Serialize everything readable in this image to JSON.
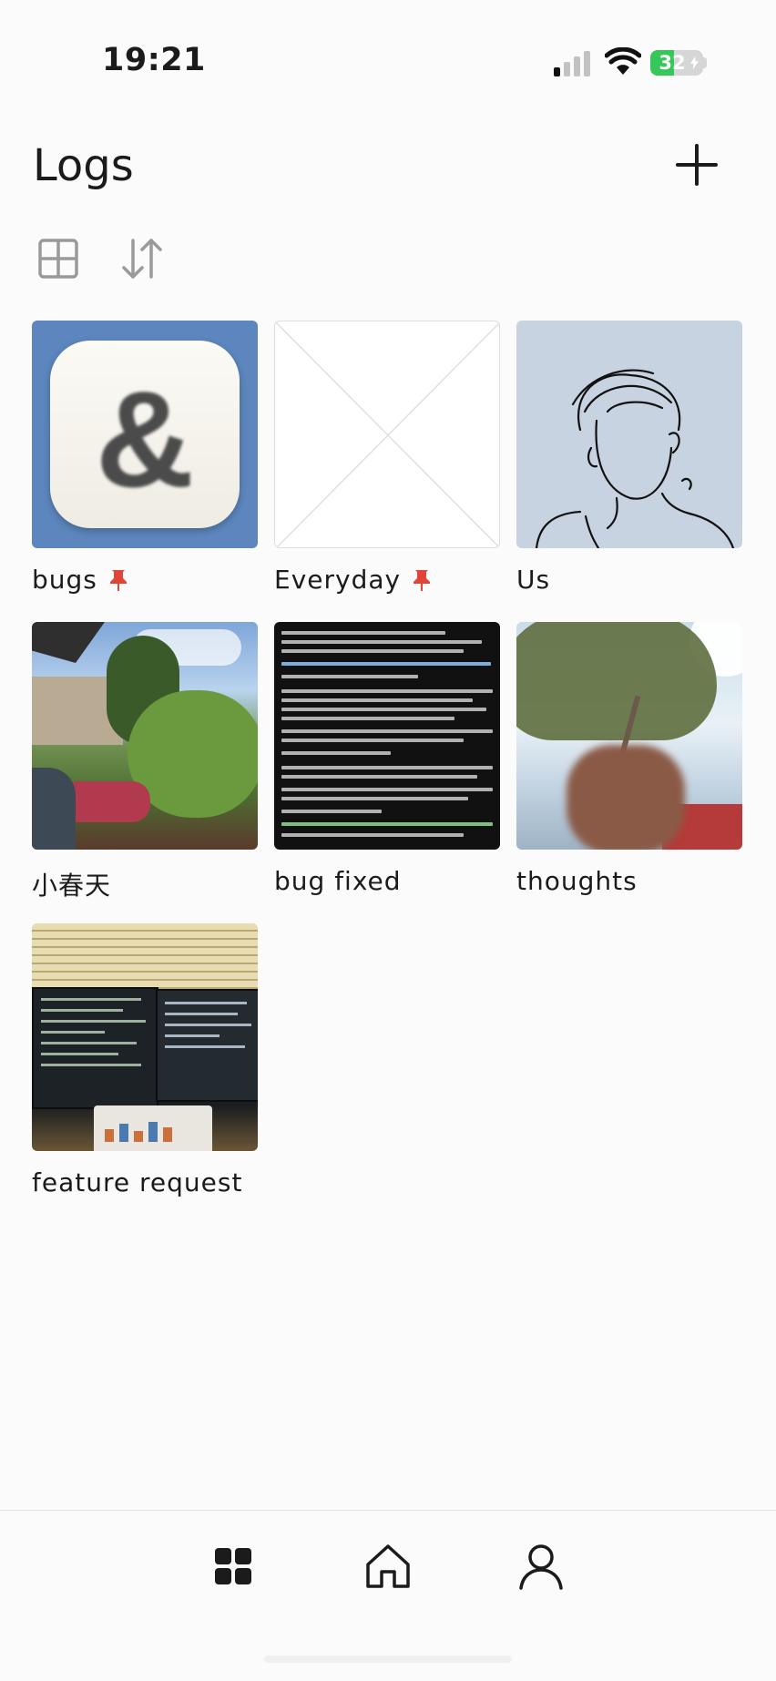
{
  "status_bar": {
    "time": "19:21",
    "signal_icon": "cellular-signal-icon",
    "wifi_icon": "wifi-icon",
    "battery_percent": "32",
    "battery_charging": true
  },
  "header": {
    "title": "Logs",
    "add_icon": "plus-icon"
  },
  "toolbar": {
    "view_icon": "grid-layout-icon",
    "sort_icon": "sort-arrows-icon"
  },
  "logs": [
    {
      "label": "bugs",
      "pinned": true,
      "thumbnail": "ampersand-app-icon"
    },
    {
      "label": "Everyday",
      "pinned": true,
      "thumbnail": "empty-placeholder"
    },
    {
      "label": "Us",
      "pinned": false,
      "thumbnail": "line-drawing-portrait"
    },
    {
      "label": "小春天",
      "pinned": false,
      "thumbnail": "garden-photo"
    },
    {
      "label": "bug fixed",
      "pinned": false,
      "thumbnail": "terminal-screenshot"
    },
    {
      "label": "thoughts",
      "pinned": false,
      "thumbnail": "tree-selfie-photo"
    },
    {
      "label": "feature request",
      "pinned": false,
      "thumbnail": "monitors-photo"
    }
  ],
  "colors": {
    "pin": "#e0453a",
    "background": "#fbfbfb",
    "text": "#1b1b1b"
  },
  "bottom_nav": [
    {
      "name": "grid",
      "icon": "four-squares-icon",
      "active": true
    },
    {
      "name": "home",
      "icon": "home-icon",
      "active": false
    },
    {
      "name": "profile",
      "icon": "person-icon",
      "active": false
    }
  ]
}
